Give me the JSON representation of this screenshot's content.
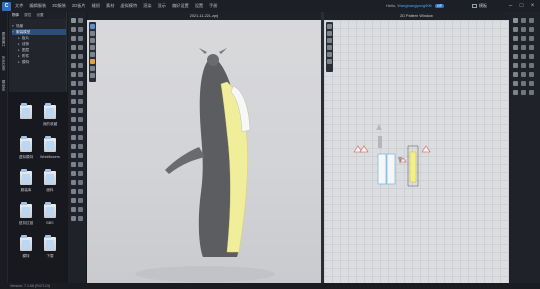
{
  "app": {
    "logo_text": "C"
  },
  "menu": [
    "文件",
    "编辑服装",
    "3D服装",
    "2D板片",
    "缝纫",
    "素材",
    "虚拟模特",
    "渲染",
    "显示",
    "偏好设置",
    "设置",
    "手册"
  ],
  "user": {
    "hello": "Hello,",
    "name": "Wangbangyang996",
    "badge": "VIP"
  },
  "pc_button": "模板",
  "window_controls": {
    "minimize": "–",
    "maximize": "□",
    "close": "×"
  },
  "left_rail": [
    "图库窗口",
    "历史记录",
    "模块库"
  ],
  "object_panel": {
    "tabs": [
      "物体",
      "属性",
      "设置"
    ],
    "tree": [
      {
        "label": "场景",
        "level": 1,
        "selected": false
      },
      {
        "label": "服装模型",
        "level": 1,
        "selected": true
      },
      {
        "label": "板片",
        "level": 2,
        "selected": false
      },
      {
        "label": "线条",
        "level": 2,
        "selected": false
      },
      {
        "label": "图层",
        "level": 2,
        "selected": false
      },
      {
        "label": "附件",
        "level": 2,
        "selected": false
      },
      {
        "label": "模特",
        "level": 2,
        "selected": false
      }
    ]
  },
  "library": [
    {
      "label": ""
    },
    {
      "label": "我的收藏"
    },
    {
      "label": "虚拟模特"
    },
    {
      "label": "Workflowers"
    },
    {
      "label": "服装库"
    },
    {
      "label": "面料"
    },
    {
      "label": "纽扣拉链"
    },
    {
      "label": "BBS"
    },
    {
      "label": "模特"
    },
    {
      "label": "下载"
    }
  ],
  "view3d": {
    "title": "2021-11-22L.zprj"
  },
  "view2d": {
    "title": "2D Pattern Window"
  },
  "status": {
    "version": "Version: 7.1.68 (R47124)"
  },
  "colors": {
    "accent": "#2b6fc9",
    "highlight_pattern": "#f3f08a",
    "selection": "#2c4f7a"
  }
}
